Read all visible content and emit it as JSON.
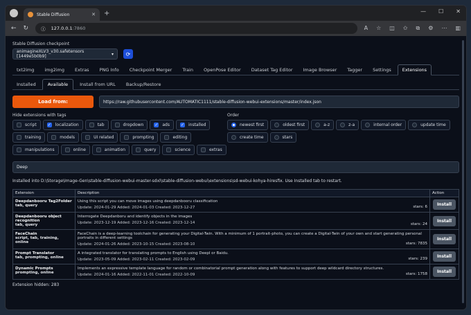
{
  "browser": {
    "tab_title": "Stable Diffusion",
    "address_host": "127.0.0.1",
    "address_port": ":7860"
  },
  "checkpoint": {
    "label": "Stable Diffusion checkpoint",
    "value": "animagineXLV3_v30.safetensors [1449e5b0b9]"
  },
  "main_tabs": [
    "txt2img",
    "img2img",
    "Extras",
    "PNG Info",
    "Checkpoint Merger",
    "Train",
    "OpenPose Editor",
    "Dataset Tag Editor",
    "Image Browser",
    "Tagger",
    "Settings",
    "Extensions"
  ],
  "sub_tabs": [
    "Installed",
    "Available",
    "Install from URL",
    "Backup/Restore"
  ],
  "load_button": "Load from:",
  "index_url": "https://raw.githubusercontent.com/AUTOMATIC1111/stable-diffusion-webui-extensions/master/index.json",
  "hide_label": "Hide extensions with tags",
  "hide_tags": [
    {
      "label": "script",
      "checked": false
    },
    {
      "label": "localization",
      "checked": true
    },
    {
      "label": "tab",
      "checked": false
    },
    {
      "label": "dropdown",
      "checked": false
    },
    {
      "label": "ads",
      "checked": true
    },
    {
      "label": "installed",
      "checked": true
    },
    {
      "label": "training",
      "checked": false
    },
    {
      "label": "models",
      "checked": false
    },
    {
      "label": "UI related",
      "checked": false
    },
    {
      "label": "prompting",
      "checked": false
    },
    {
      "label": "editing",
      "checked": false
    },
    {
      "label": "manipulations",
      "checked": false
    },
    {
      "label": "online",
      "checked": false
    },
    {
      "label": "animation",
      "checked": false
    },
    {
      "label": "query",
      "checked": false
    },
    {
      "label": "science",
      "checked": false
    },
    {
      "label": "extras",
      "checked": false
    }
  ],
  "order_label": "Order",
  "order_options": [
    {
      "label": "newest first",
      "checked": true
    },
    {
      "label": "oldest first",
      "checked": false
    },
    {
      "label": "a-z",
      "checked": false
    },
    {
      "label": "z-a",
      "checked": false
    },
    {
      "label": "internal order",
      "checked": false
    },
    {
      "label": "update time",
      "checked": false
    },
    {
      "label": "create time",
      "checked": false
    },
    {
      "label": "stars",
      "checked": false
    }
  ],
  "search_value": "Deep",
  "installed_message": "Installed into D:\\Storage\\Image-Gen\\stable-diffusion-webui-master-sdxl\\stable-diffusion-webui\\extensions\\sd-webui-kohya-hiresfix. Use Installed tab to restart.",
  "table": {
    "headers": [
      "Extension",
      "Description",
      "Action"
    ],
    "rows": [
      {
        "name": "Deepdanbooru Tag2Folder",
        "tags": "tab, query",
        "desc": "Using this script you can move images using deepdanbooru classification",
        "meta": "Update: 2024-01-29 Added: 2024-01-03 Created: 2023-12-27",
        "stars": "stars: 6",
        "action": "Install"
      },
      {
        "name": "Deepdanbooru object recognition",
        "tags": "tab, query",
        "desc": "Interrogate Deepdanboru and identify objects in the images",
        "meta": "Update: 2023-12-19 Added: 2023-12-16 Created: 2023-12-14",
        "stars": "stars: 24",
        "action": "Install"
      },
      {
        "name": "FaceChain",
        "tags": "script, tab, training, online",
        "desc": "FaceChain is a deep-learning toolchain for generating your Digital-Twin. With a minimum of 1 portrait-photo, you can create a Digital-Twin of your own and start generating personal portraits in different settings",
        "meta": "Update: 2024-01-26 Added: 2023-10-15 Created: 2023-08-10",
        "stars": "stars: 7835",
        "action": "Install"
      },
      {
        "name": "Prompt Translator",
        "tags": "tab, prompting, online",
        "desc": "A integrated translator for translating prompts to English using Deepl or Baidu.",
        "meta": "Update: 2023-05-09 Added: 2023-02-11 Created: 2023-02-09",
        "stars": "stars: 239",
        "action": "Install"
      },
      {
        "name": "Dynamic Prompts",
        "tags": "prompting, online",
        "desc": "Implements an expressive template language for random or combinatorial prompt generation along with features to support deep wildcard directory structures.",
        "meta": "Update: 2024-01-16 Added: 2022-11-01 Created: 2022-10-09",
        "stars": "stars: 1758",
        "action": "Install"
      }
    ]
  },
  "hidden_count": "Extension hidden: 283"
}
